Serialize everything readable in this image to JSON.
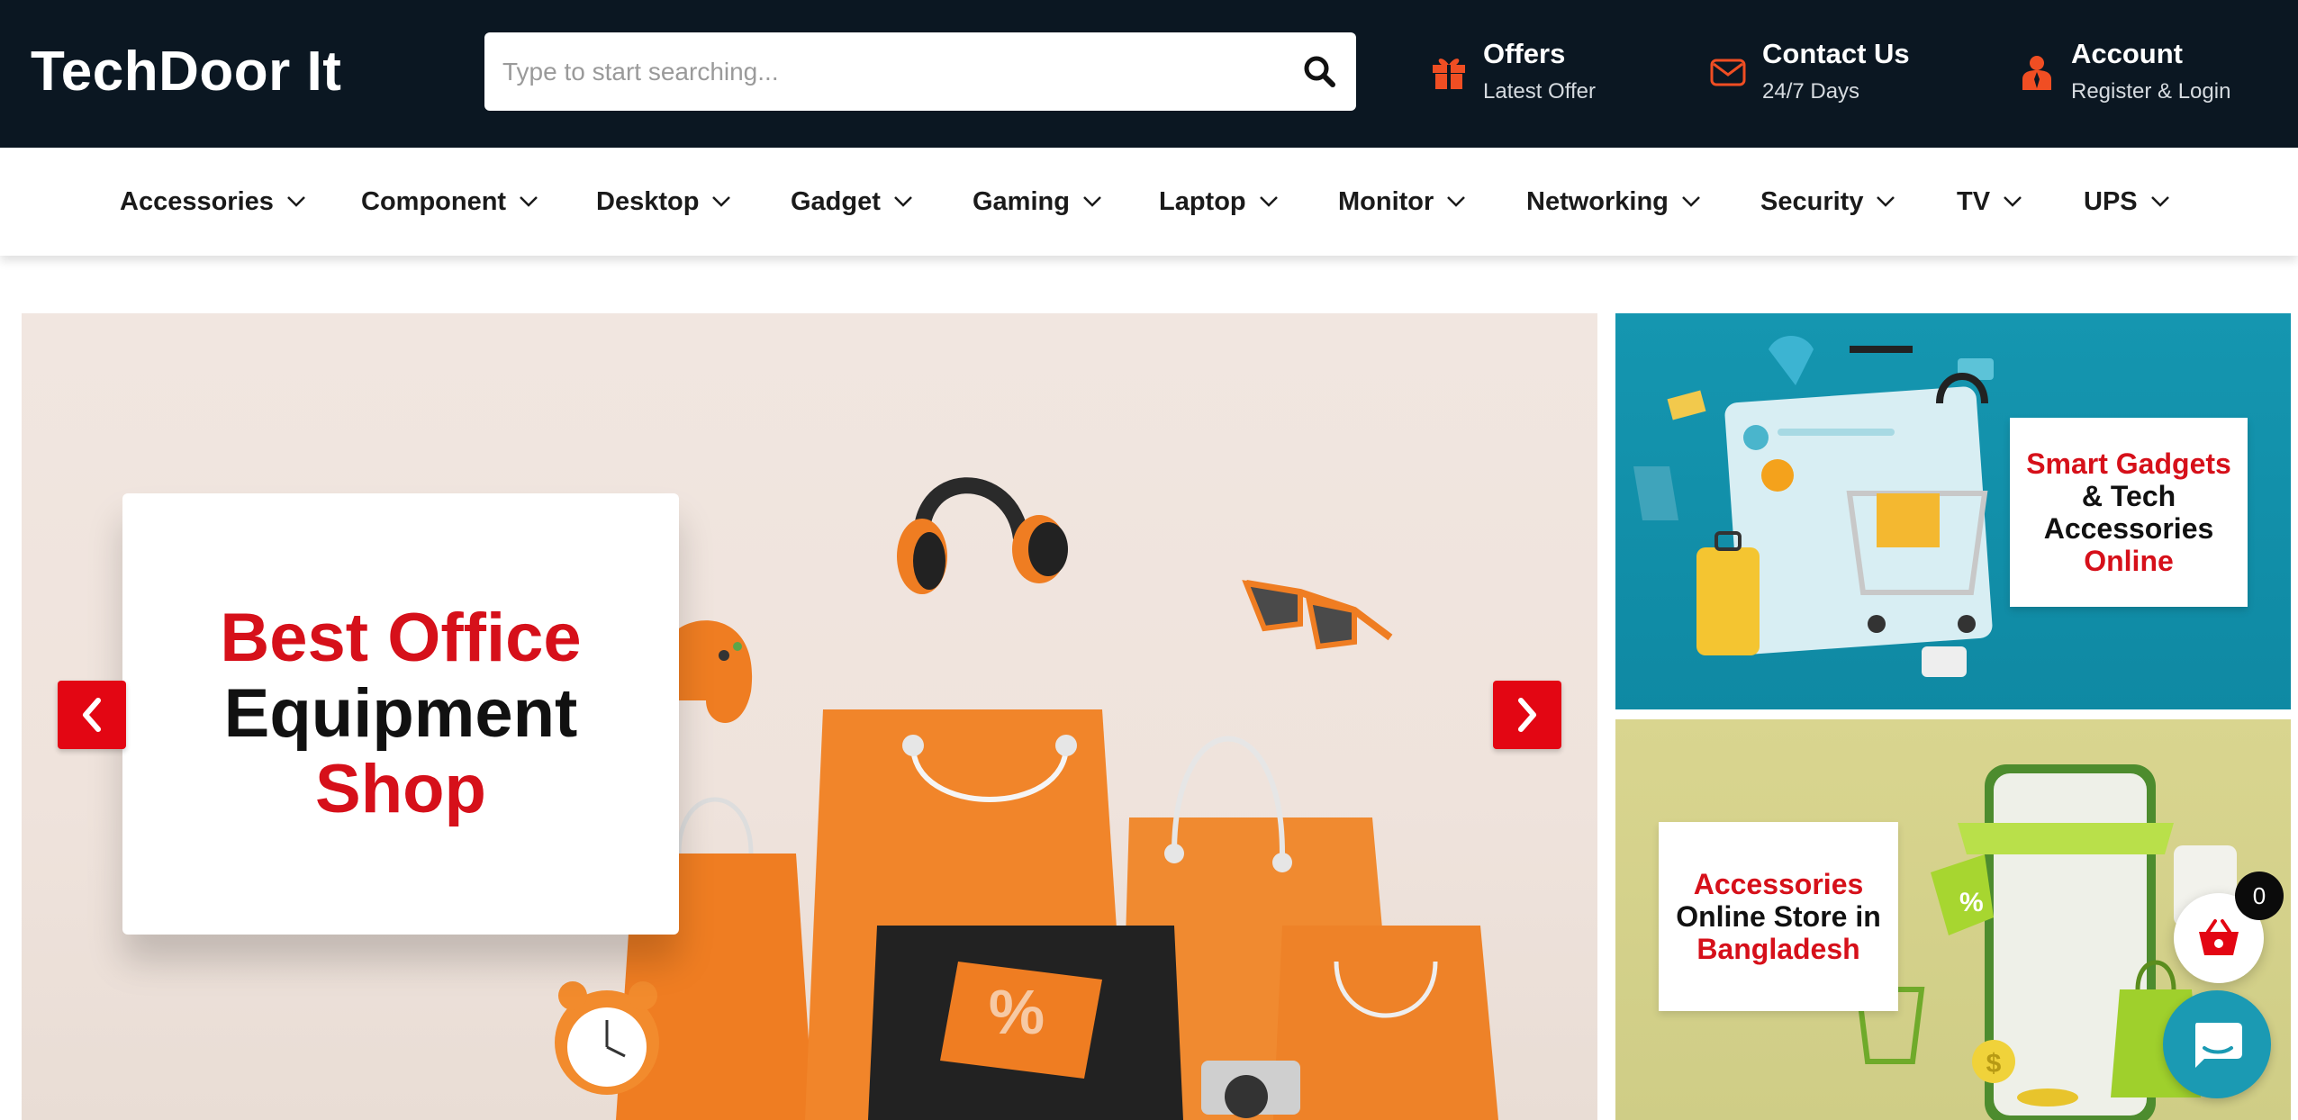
{
  "header": {
    "logo": "TechDoor It",
    "search_placeholder": "Type to start searching...",
    "offers": {
      "title": "Offers",
      "subtitle": "Latest Offer"
    },
    "contact": {
      "title": "Contact Us",
      "subtitle": "24/7 Days"
    },
    "account": {
      "title": "Account",
      "subtitle": "Register & Login"
    }
  },
  "nav": [
    {
      "label": "Accessories"
    },
    {
      "label": "Component"
    },
    {
      "label": "Desktop"
    },
    {
      "label": "Gadget"
    },
    {
      "label": "Gaming"
    },
    {
      "label": "Laptop"
    },
    {
      "label": "Monitor"
    },
    {
      "label": "Networking"
    },
    {
      "label": "Security"
    },
    {
      "label": "TV"
    },
    {
      "label": "UPS"
    }
  ],
  "hero": {
    "line1": "Best Office",
    "line2": "Equipment",
    "line3": "Shop"
  },
  "side_banner_1": {
    "line1": "Smart Gadgets",
    "line2": "& Tech",
    "line3": "Accessories",
    "line4": "Online"
  },
  "side_banner_2": {
    "line1": "Accessories",
    "line2": "Online Store in",
    "line3": "Bangladesh"
  },
  "cart": {
    "count": "0"
  },
  "colors": {
    "header_bg": "#0b1722",
    "accent_red": "#e30613",
    "icon_orange": "#f04e23",
    "chat_teal": "#1b9ab3"
  }
}
